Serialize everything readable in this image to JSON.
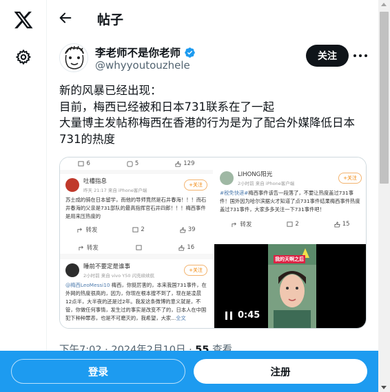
{
  "header": {
    "title": "帖子"
  },
  "author": {
    "name": "李老师不是你老师",
    "handle": "@whyyoutouzhele",
    "follow_label": "关注"
  },
  "tweet": {
    "lines": [
      "新的风暴已经出现：",
      "目前，梅西已经被和日本731联系在了一起",
      "大量博主发帖称梅西在香港的行为是为了配合外媒降低日本",
      "731的热度"
    ],
    "timestamp": "下午7:02 · 2024年2月10日 · ",
    "views_count": "55",
    "views_label": " 查看"
  },
  "media": {
    "left_top_bar": {
      "comments": "6",
      "reposts": "5",
      "likes": "129"
    },
    "post1": {
      "user": "吐槽指息",
      "meta": "昨天 21:17  来自 iPhone客户端",
      "follow": "+关注",
      "body": "苏士成的骑在日本留学，而他的导师竟然是石井春海！！！而石井春海的父亲是731部队的最高指挥官石井四郎！！！梅西事件是用来压热度的",
      "bar": {
        "repost": "转发",
        "comments": "2",
        "likes": "39"
      }
    },
    "post1_bar2": {
      "repost": "转发",
      "likes": "16"
    },
    "post2": {
      "user": "睡前不要定是谁事",
      "meta": "2小时前  来自 vivo Y50 闪充续续航",
      "follow": "+关注",
      "mention": "@梅西LeoMessi10",
      "body": " 梅西，你挺厉害的，本来我国731事件，在外网的热度很高的，因为，你现在根本搜不到了，现在是凌晨12点半，大半夜的还是过2年。我发这条微博的意义就是，不管，你做任何事情，发生过的事实是改变不了的，日本人在中国犯下种种罪恶，也是不可磨灭的，我希望，大家...",
      "more": "全文"
    },
    "post3": {
      "user": "LIHONG阳光",
      "meta": "2小时前  来自 iPhone客户端",
      "follow": "+关注",
      "tag": "#税免快递#",
      "body": "梅西事件该告一段落了，不要让热度盖过731事件！国外因为哈尔滨据火才知道了点731事件结果梅西事件热度盖过731事件，大家多多关注一下731事件吧！",
      "bar": {
        "repost": "转发",
        "comments": "2",
        "likes": "15"
      }
    },
    "video": {
      "duration": "0:45",
      "caption": "我的天啊之后"
    }
  },
  "bottom_bar": {
    "login": "登录",
    "signup": "注册"
  },
  "colors": {
    "accent": "#1d9bf0",
    "verified": "#1d9bf0",
    "weibo_orange": "#f08200"
  }
}
